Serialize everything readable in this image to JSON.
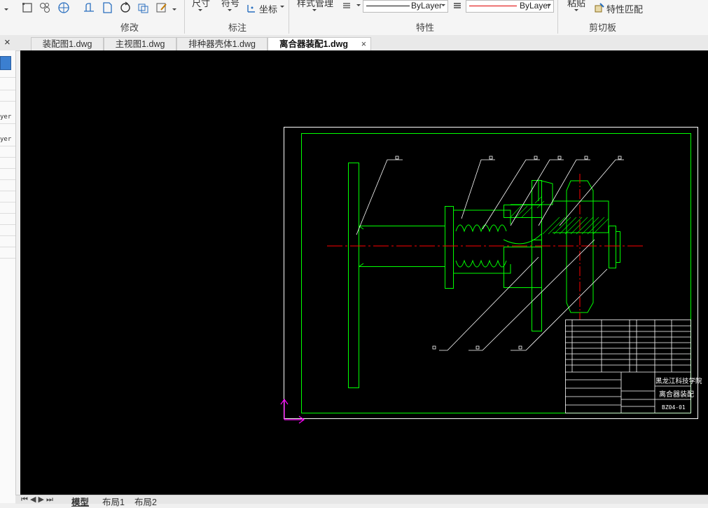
{
  "ribbon": {
    "modify_label": "修改",
    "annotate_label": "标注",
    "properties_label": "特性",
    "clipboard_label": "剪切板",
    "dimension_label": "尺寸",
    "symbol_label": "符号",
    "coordinate_label": "坐标",
    "style_manager_label": "样式管理",
    "paste_label": "粘贴",
    "match_properties_label": "特性匹配",
    "linetype_value": "ByLayer",
    "color_value": "ByLayer"
  },
  "tabs": [
    {
      "label": "装配图1.dwg"
    },
    {
      "label": "主视图1.dwg"
    },
    {
      "label": "排种器壳体1.dwg"
    },
    {
      "label": "离合器装配1.dwg",
      "active": true
    }
  ],
  "tab_close_glyph": "×",
  "panel_close_glyph": "×",
  "left_panel": {
    "values": [
      "yer",
      "yer"
    ]
  },
  "layout_tabs": [
    "模型",
    "布局1",
    "布局2"
  ],
  "drawing": {
    "school": "黑龙江科技学院",
    "title": "离合器装配",
    "code": "BZ04-01",
    "part_labels": [
      "1",
      "2",
      "3",
      "4",
      "5",
      "6",
      "7",
      "8",
      "9"
    ]
  },
  "colors": {
    "line_green": "#00ff00",
    "center_red": "#ff0000",
    "ucs_magenta": "#ff00ff",
    "frame_white": "#ffffff"
  }
}
